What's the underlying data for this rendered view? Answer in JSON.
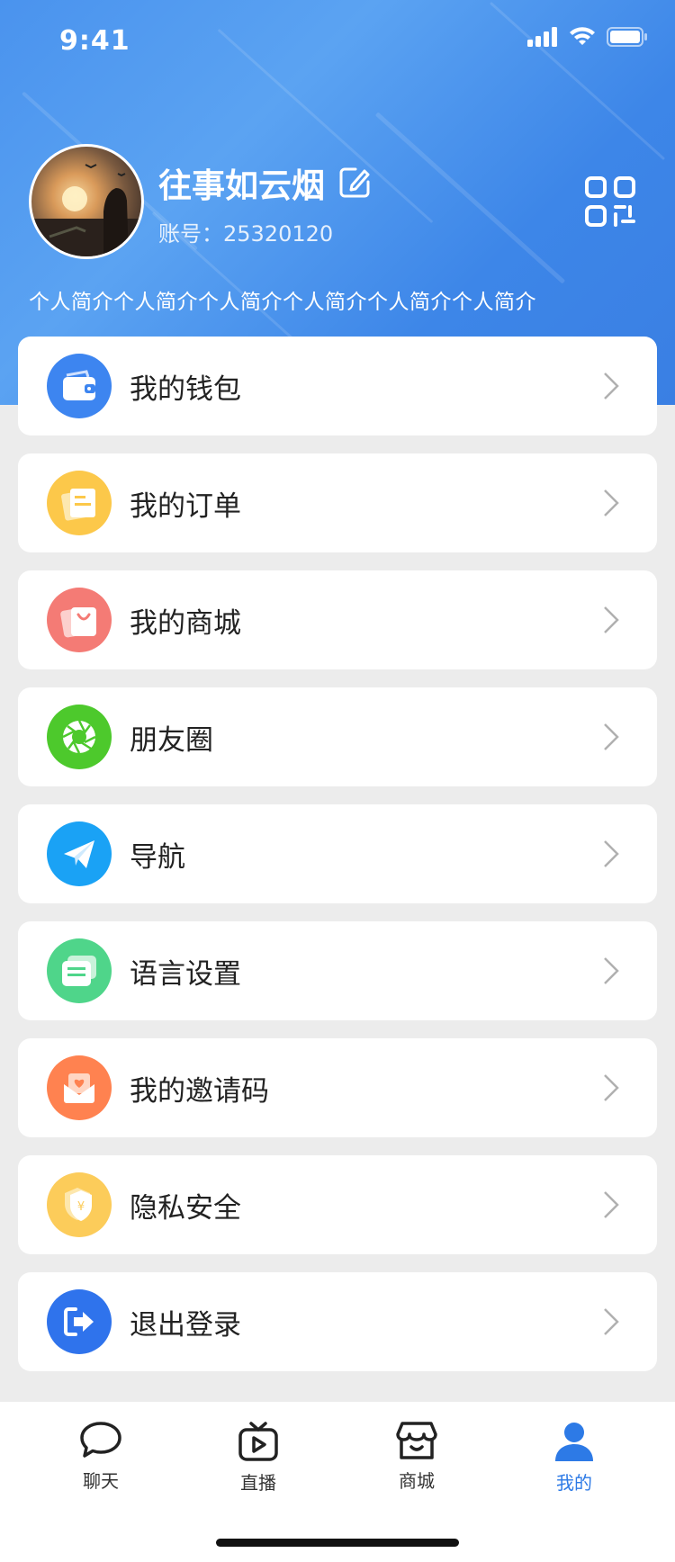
{
  "status_bar": {
    "time": "9:41",
    "icons": [
      "signal-icon",
      "wifi-icon",
      "battery-icon"
    ]
  },
  "profile": {
    "username": "往事如云烟",
    "account": "账号：25320120",
    "bio": "个人简介个人简介个人简介个人简介个人简介个人简介",
    "icons": [
      "avatar",
      "edit-icon",
      "qr-code-icon"
    ]
  },
  "menu": [
    {
      "label": "我的钱包",
      "icon": "wallet-icon",
      "color": "#3d85f0"
    },
    {
      "label": "我的订单",
      "icon": "order-icon",
      "color": "#fcc84a"
    },
    {
      "label": "我的商城",
      "icon": "shopping-bag-icon",
      "color": "#f47b75"
    },
    {
      "label": "朋友圈",
      "icon": "moments-aperture-icon",
      "color": "#4dc92c"
    },
    {
      "label": "导航",
      "icon": "paper-plane-icon",
      "color": "#1aa2f5"
    },
    {
      "label": "语言设置",
      "icon": "language-card-icon",
      "color": "#4fd58a"
    },
    {
      "label": "我的邀请码",
      "icon": "invite-envelope-icon",
      "color": "#ff8250"
    },
    {
      "label": "隐私安全",
      "icon": "shield-icon",
      "color": "#fccc5a"
    },
    {
      "label": "退出登录",
      "icon": "logout-icon",
      "color": "#2f73ec"
    }
  ],
  "tabbar": {
    "tabs": [
      {
        "label": "聊天",
        "icon": "chat-bubble-icon"
      },
      {
        "label": "直播",
        "icon": "live-tv-icon"
      },
      {
        "label": "商城",
        "icon": "store-icon"
      },
      {
        "label": "我的",
        "icon": "user-icon"
      }
    ],
    "active_index": 3,
    "active_color": "#2d7ae6"
  },
  "colors": {
    "header": "#4a93ee",
    "background": "#ececec"
  }
}
